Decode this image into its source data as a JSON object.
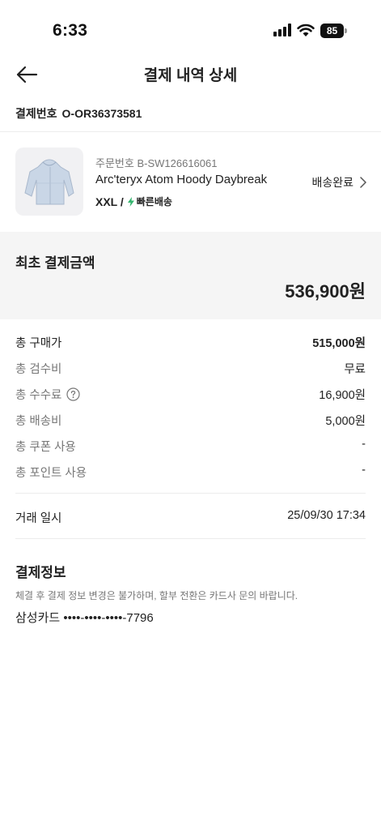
{
  "status_bar": {
    "time": "6:33",
    "battery": "85"
  },
  "nav": {
    "title": "결제 내역 상세"
  },
  "payment": {
    "label": "결제번호",
    "number": "O-OR36373581"
  },
  "product": {
    "order_number": "주문번호 B-SW126616061",
    "name": "Arc'teryx Atom Hoody Daybreak",
    "size": "XXL /",
    "shipping": "빠른배송",
    "status": "배송완료"
  },
  "initial": {
    "label": "최초 결제금액",
    "amount": "536,900원"
  },
  "breakdown": [
    {
      "label": "총 구매가",
      "value": "515,000원"
    },
    {
      "label": "총 검수비",
      "value": "무료"
    },
    {
      "label": "총 수수료",
      "value": "16,900원"
    },
    {
      "label": "총 배송비",
      "value": "5,000원"
    },
    {
      "label": "총 쿠폰 사용",
      "value": "-"
    },
    {
      "label": "총 포인트 사용",
      "value": "-"
    }
  ],
  "transaction": {
    "label": "거래 일시",
    "value": "25/09/30 17:34"
  },
  "payment_info": {
    "title": "결제정보",
    "notice": "체결 후 결제 정보 변경은 불가하며, 할부 전환은 카드사 문의 바랍니다.",
    "card": "삼성카드 ••••-••••-••••-7796"
  },
  "colors": {
    "accent_green": "#31b46c",
    "muted_text": "#777777",
    "section_bg": "#f5f5f5"
  }
}
